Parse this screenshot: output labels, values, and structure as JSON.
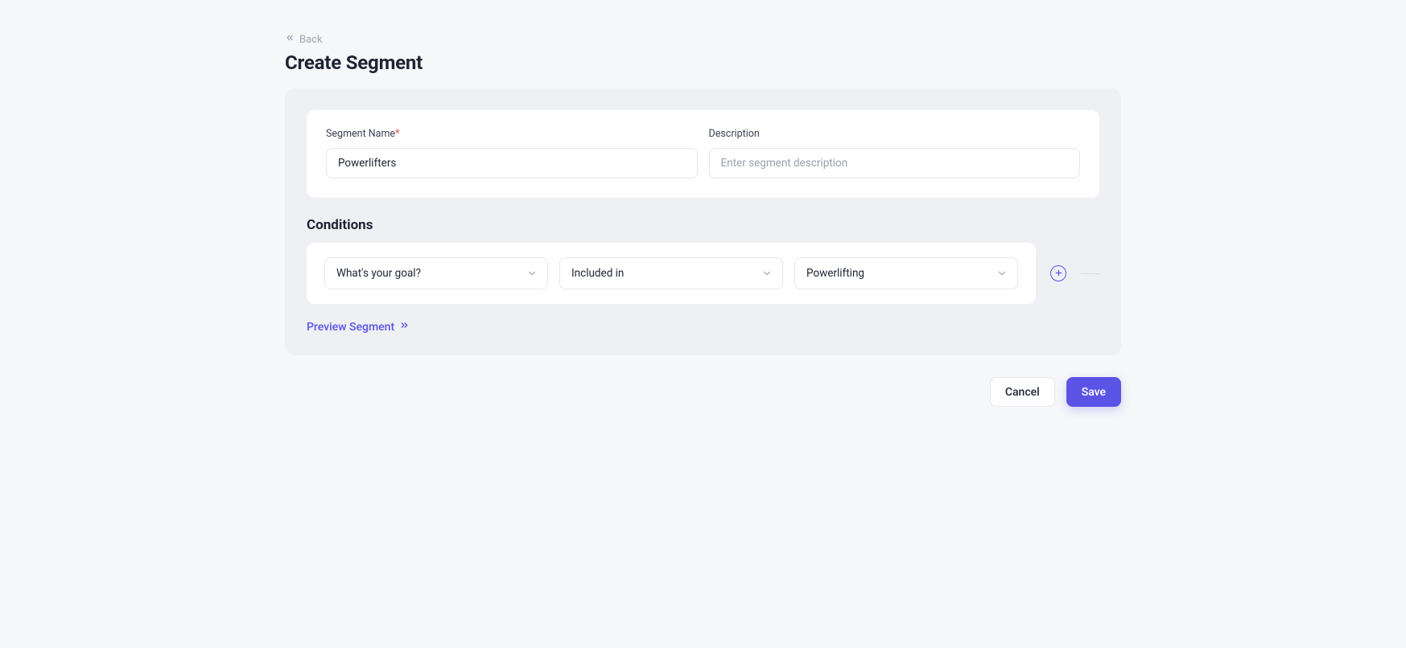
{
  "nav": {
    "back_label": "Back"
  },
  "page": {
    "title": "Create Segment"
  },
  "form": {
    "segment_name": {
      "label": "Segment Name",
      "value": "Powerlifters",
      "required_mark": "*"
    },
    "description": {
      "label": "Description",
      "value": "",
      "placeholder": "Enter segment description"
    }
  },
  "conditions": {
    "heading": "Conditions",
    "rows": [
      {
        "field_select": "What's your goal?",
        "operator_select": "Included in",
        "value_select": "Powerlifting"
      }
    ]
  },
  "preview": {
    "label": "Preview Segment"
  },
  "actions": {
    "cancel": "Cancel",
    "save": "Save"
  },
  "colors": {
    "accent": "#5b53e6",
    "panel_bg": "#eef0f4",
    "body_bg": "#f6f7f9",
    "border": "#e4e7ec",
    "text": "#1e2433",
    "muted": "#9aa1ae",
    "danger": "#e5484d"
  }
}
